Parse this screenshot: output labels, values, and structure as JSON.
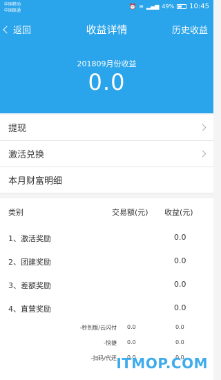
{
  "status_bar": {
    "carrier_1": "中国移动",
    "carrier_2": "中国联通",
    "battery": "49%",
    "time": "10:45"
  },
  "nav": {
    "back_label": "返回",
    "title": "收益详情",
    "history_label": "历史收益"
  },
  "summary": {
    "month_label": "201809月份收益",
    "value": "0.0"
  },
  "menu": {
    "withdraw": "提现",
    "activate_redeem": "激活兑换",
    "monthly_detail": "本月财富明细"
  },
  "table": {
    "headers": [
      "类别",
      "交易额(元)",
      "收益(元)"
    ],
    "rows": [
      {
        "label": "1、激活奖励",
        "amount": "",
        "income": "0.0"
      },
      {
        "label": "2、团建奖励",
        "amount": "",
        "income": "0.0"
      },
      {
        "label": "3、差额奖励",
        "amount": "",
        "income": "0.0"
      },
      {
        "label": "4、直营奖励",
        "amount": "",
        "income": "0.0"
      }
    ],
    "subrows": [
      {
        "label": "-秒到版/云闪付",
        "amount": "0.0",
        "income": "0.0"
      },
      {
        "label": "-快捷",
        "amount": "0.0",
        "income": "0.0"
      },
      {
        "label": "-扫码/代还",
        "amount": "0.0",
        "income": "0.0"
      }
    ]
  },
  "watermark": "ITMOP.COM",
  "colors": {
    "header_bg": "#2aa4ea",
    "text_dark": "#333333"
  }
}
